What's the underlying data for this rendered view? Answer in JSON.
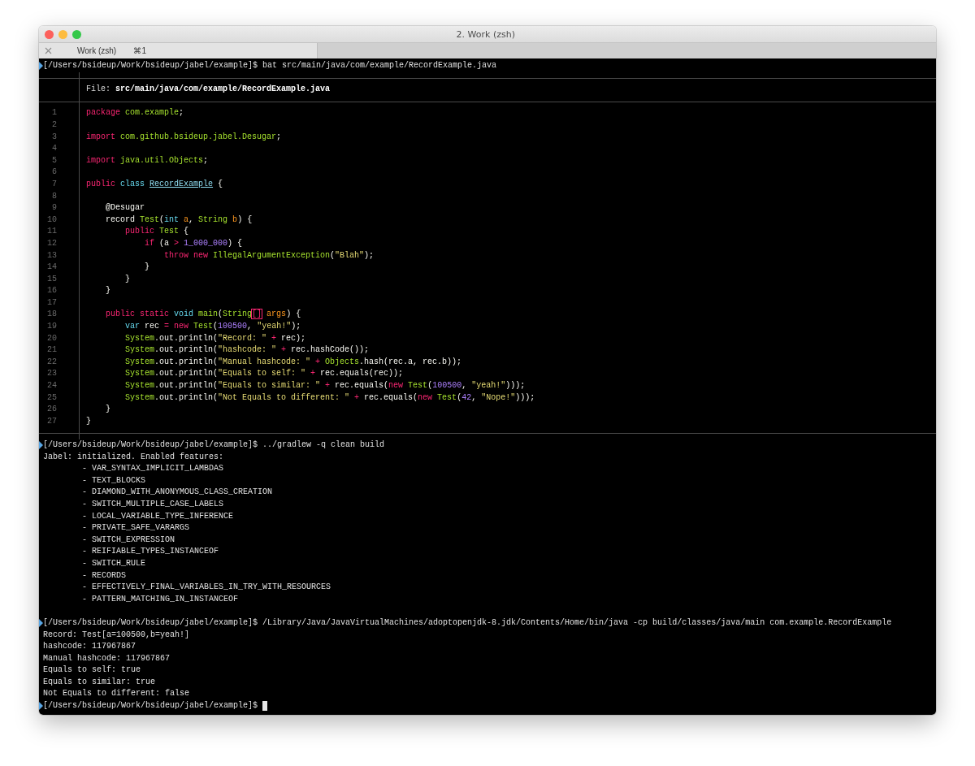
{
  "window": {
    "title": "2. Work (zsh)"
  },
  "tabs": [
    {
      "label": "Work (zsh)",
      "shortcut": "⌘1",
      "selected": true
    }
  ],
  "terminal": {
    "command_1": {
      "prompt": "[/Users/bsideup/Work/bsideup/jabel/example]$",
      "command": "bat src/main/java/com/example/RecordExample.java"
    },
    "file_viewer": {
      "label": "File:",
      "path": "src/main/java/com/example/RecordExample.java",
      "lines": [
        {
          "number": "1",
          "tokens": [
            {
              "text": "package",
              "kind": "keyword"
            },
            {
              "text": " com.example",
              "kind": "type"
            },
            {
              "text": ";",
              "kind": "plain"
            }
          ]
        },
        {
          "number": "2"
        },
        {
          "number": "3",
          "tokens": [
            {
              "text": "import",
              "kind": "keyword"
            },
            {
              "text": " com.github.bsideup.jabel.Desugar",
              "kind": "type"
            },
            {
              "text": ";",
              "kind": "plain"
            }
          ]
        },
        {
          "number": "4"
        },
        {
          "number": "5",
          "tokens": [
            {
              "text": "import",
              "kind": "keyword"
            },
            {
              "text": " java.util.Objects",
              "kind": "type"
            },
            {
              "text": ";",
              "kind": "plain"
            }
          ]
        },
        {
          "number": "6"
        },
        {
          "number": "7",
          "tokens": [
            {
              "text": "public ",
              "kind": "keyword"
            },
            {
              "text": "class ",
              "kind": "storage"
            },
            {
              "text": "RecordExample",
              "kind": "classname"
            },
            {
              "text": " {",
              "kind": "plain"
            }
          ]
        },
        {
          "number": "8"
        },
        {
          "number": "9",
          "tokens": [
            {
              "text": "    @Desugar",
              "kind": "plain"
            }
          ]
        },
        {
          "number": "10",
          "tokens": [
            {
              "text": "    record ",
              "kind": "plain"
            },
            {
              "text": "Test",
              "kind": "type"
            },
            {
              "text": "(",
              "kind": "plain"
            },
            {
              "text": "int ",
              "kind": "storage"
            },
            {
              "text": "a",
              "kind": "param"
            },
            {
              "text": ", ",
              "kind": "plain"
            },
            {
              "text": "String ",
              "kind": "type"
            },
            {
              "text": "b",
              "kind": "param"
            },
            {
              "text": ") {",
              "kind": "plain"
            }
          ]
        },
        {
          "number": "11",
          "tokens": [
            {
              "text": "        public ",
              "kind": "keyword"
            },
            {
              "text": "Test",
              "kind": "type"
            },
            {
              "text": " {",
              "kind": "plain"
            }
          ]
        },
        {
          "number": "12",
          "tokens": [
            {
              "text": "            if",
              "kind": "keyword"
            },
            {
              "text": " (a ",
              "kind": "plain"
            },
            {
              "text": "> ",
              "kind": "keyword"
            },
            {
              "text": "1_000_000",
              "kind": "number"
            },
            {
              "text": ") {",
              "kind": "plain"
            }
          ]
        },
        {
          "number": "13",
          "tokens": [
            {
              "text": "                throw ",
              "kind": "keyword"
            },
            {
              "text": "new ",
              "kind": "keyword"
            },
            {
              "text": "IllegalArgumentException",
              "kind": "type"
            },
            {
              "text": "(",
              "kind": "plain"
            },
            {
              "text": "\"Blah\"",
              "kind": "string"
            },
            {
              "text": ");",
              "kind": "plain"
            }
          ]
        },
        {
          "number": "14",
          "tokens": [
            {
              "text": "            }",
              "kind": "plain"
            }
          ]
        },
        {
          "number": "15",
          "tokens": [
            {
              "text": "        }",
              "kind": "plain"
            }
          ]
        },
        {
          "number": "16",
          "tokens": [
            {
              "text": "    }",
              "kind": "plain"
            }
          ]
        },
        {
          "number": "17"
        },
        {
          "number": "18",
          "tokens": [
            {
              "text": "    public ",
              "kind": "keyword"
            },
            {
              "text": "static ",
              "kind": "keyword"
            },
            {
              "text": "void ",
              "kind": "storage"
            },
            {
              "text": "main",
              "kind": "type"
            },
            {
              "text": "(",
              "kind": "plain"
            },
            {
              "text": "String",
              "kind": "type"
            },
            {
              "text": "[]",
              "kind": "invalid"
            },
            {
              "text": " args",
              "kind": "param"
            },
            {
              "text": ") {",
              "kind": "plain"
            }
          ]
        },
        {
          "number": "19",
          "tokens": [
            {
              "text": "        var",
              "kind": "storage"
            },
            {
              "text": " rec ",
              "kind": "plain"
            },
            {
              "text": "= ",
              "kind": "keyword"
            },
            {
              "text": "new ",
              "kind": "keyword"
            },
            {
              "text": "Test",
              "kind": "type"
            },
            {
              "text": "(",
              "kind": "plain"
            },
            {
              "text": "100500",
              "kind": "number"
            },
            {
              "text": ", ",
              "kind": "plain"
            },
            {
              "text": "\"yeah!\"",
              "kind": "string"
            },
            {
              "text": ");",
              "kind": "plain"
            }
          ]
        },
        {
          "number": "20",
          "tokens": [
            {
              "text": "        System",
              "kind": "type"
            },
            {
              "text": ".out.println(",
              "kind": "plain"
            },
            {
              "text": "\"Record: \" ",
              "kind": "string"
            },
            {
              "text": "+",
              "kind": "keyword"
            },
            {
              "text": " rec);",
              "kind": "plain"
            }
          ]
        },
        {
          "number": "21",
          "tokens": [
            {
              "text": "        System",
              "kind": "type"
            },
            {
              "text": ".out.println(",
              "kind": "plain"
            },
            {
              "text": "\"hashcode: \" ",
              "kind": "string"
            },
            {
              "text": "+",
              "kind": "keyword"
            },
            {
              "text": " rec.hashCode());",
              "kind": "plain"
            }
          ]
        },
        {
          "number": "22",
          "tokens": [
            {
              "text": "        System",
              "kind": "type"
            },
            {
              "text": ".out.println(",
              "kind": "plain"
            },
            {
              "text": "\"Manual hashcode: \" ",
              "kind": "string"
            },
            {
              "text": "+ ",
              "kind": "keyword"
            },
            {
              "text": "Objects",
              "kind": "type"
            },
            {
              "text": ".hash(rec.a, rec.b));",
              "kind": "plain"
            }
          ]
        },
        {
          "number": "23",
          "tokens": [
            {
              "text": "        System",
              "kind": "type"
            },
            {
              "text": ".out.println(",
              "kind": "plain"
            },
            {
              "text": "\"Equals to self: \" ",
              "kind": "string"
            },
            {
              "text": "+",
              "kind": "keyword"
            },
            {
              "text": " rec.equals(rec));",
              "kind": "plain"
            }
          ]
        },
        {
          "number": "24",
          "tokens": [
            {
              "text": "        System",
              "kind": "type"
            },
            {
              "text": ".out.println(",
              "kind": "plain"
            },
            {
              "text": "\"Equals to similar: \" ",
              "kind": "string"
            },
            {
              "text": "+",
              "kind": "keyword"
            },
            {
              "text": " rec.equals(",
              "kind": "plain"
            },
            {
              "text": "new ",
              "kind": "keyword"
            },
            {
              "text": "Test",
              "kind": "type"
            },
            {
              "text": "(",
              "kind": "plain"
            },
            {
              "text": "100500",
              "kind": "number"
            },
            {
              "text": ", ",
              "kind": "plain"
            },
            {
              "text": "\"yeah!\"",
              "kind": "string"
            },
            {
              "text": ")));",
              "kind": "plain"
            }
          ]
        },
        {
          "number": "25",
          "tokens": [
            {
              "text": "        System",
              "kind": "type"
            },
            {
              "text": ".out.println(",
              "kind": "plain"
            },
            {
              "text": "\"Not Equals to different: \" ",
              "kind": "string"
            },
            {
              "text": "+",
              "kind": "keyword"
            },
            {
              "text": " rec.equals(",
              "kind": "plain"
            },
            {
              "text": "new ",
              "kind": "keyword"
            },
            {
              "text": "Test",
              "kind": "type"
            },
            {
              "text": "(",
              "kind": "plain"
            },
            {
              "text": "42",
              "kind": "number"
            },
            {
              "text": ", ",
              "kind": "plain"
            },
            {
              "text": "\"Nope!\"",
              "kind": "string"
            },
            {
              "text": ")));",
              "kind": "plain"
            }
          ]
        },
        {
          "number": "26",
          "tokens": [
            {
              "text": "    }",
              "kind": "plain"
            }
          ]
        },
        {
          "number": "27",
          "tokens": [
            {
              "text": "}",
              "kind": "plain"
            }
          ]
        }
      ]
    },
    "command_2": {
      "prompt": "[/Users/bsideup/Work/bsideup/jabel/example]$",
      "command": "../gradlew -q clean build"
    },
    "build_output": {
      "header": "Jabel: initialized. Enabled features:",
      "features": [
        "- VAR_SYNTAX_IMPLICIT_LAMBDAS",
        "- TEXT_BLOCKS",
        "- DIAMOND_WITH_ANONYMOUS_CLASS_CREATION",
        "- SWITCH_MULTIPLE_CASE_LABELS",
        "- LOCAL_VARIABLE_TYPE_INFERENCE",
        "- PRIVATE_SAFE_VARARGS",
        "- SWITCH_EXPRESSION",
        "- REIFIABLE_TYPES_INSTANCEOF",
        "- SWITCH_RULE",
        "- RECORDS",
        "- EFFECTIVELY_FINAL_VARIABLES_IN_TRY_WITH_RESOURCES",
        "- PATTERN_MATCHING_IN_INSTANCEOF"
      ]
    },
    "command_3": {
      "prompt": "[/Users/bsideup/Work/bsideup/jabel/example]$",
      "command": "/Library/Java/JavaVirtualMachines/adoptopenjdk-8.jdk/Contents/Home/bin/java -cp build/classes/java/main com.example.RecordExample"
    },
    "run_output": [
      "Record: Test[a=100500,b=yeah!]",
      "hashcode: 117967867",
      "Manual hashcode: 117967867",
      "Equals to self: true",
      "Equals to similar: true",
      "Not Equals to different: false"
    ],
    "command_4": {
      "prompt": "[/Users/bsideup/Work/bsideup/jabel/example]$"
    }
  }
}
